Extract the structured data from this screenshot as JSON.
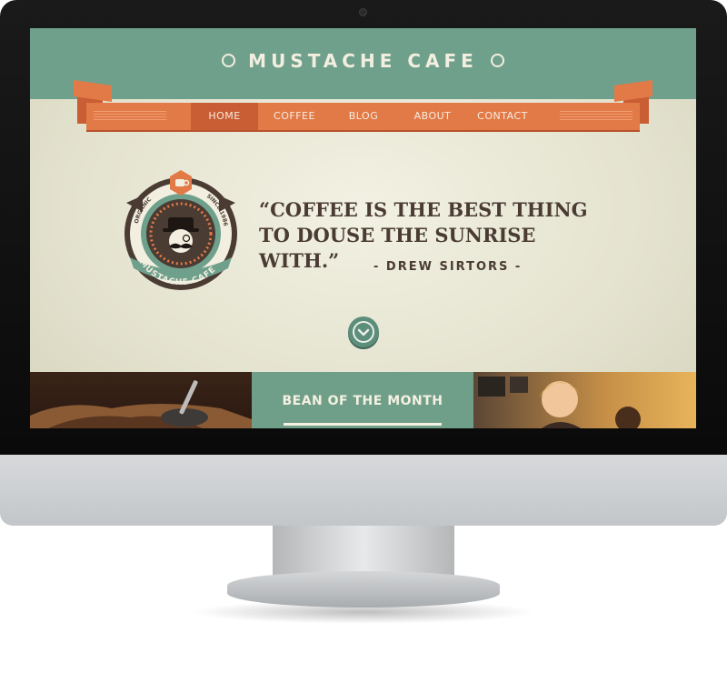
{
  "site": {
    "brand": "MUSTACHE CAFE",
    "nav": [
      {
        "label": "Home",
        "active": true
      },
      {
        "label": "Coffee",
        "active": false
      },
      {
        "label": "Blog",
        "active": false
      },
      {
        "label": "About",
        "active": false
      },
      {
        "label": "Contact",
        "active": false
      }
    ],
    "hero": {
      "quote": "“COFFEE IS THE BEST THING TO DOUSE THE SUNRISE WITH.”",
      "author": "- DREW SIRTORS -"
    },
    "badge": {
      "top_left": "ORGANIC",
      "top_right": "SINCE 1986",
      "bottom": "MUSTACHE CAFE"
    },
    "featured": {
      "bean_of_month": "BEAN OF THE MONTH"
    },
    "colors": {
      "teal": "#6fa08c",
      "orange": "#e27a48",
      "cream": "#e4e3cf",
      "brown": "#4a3b33"
    }
  }
}
